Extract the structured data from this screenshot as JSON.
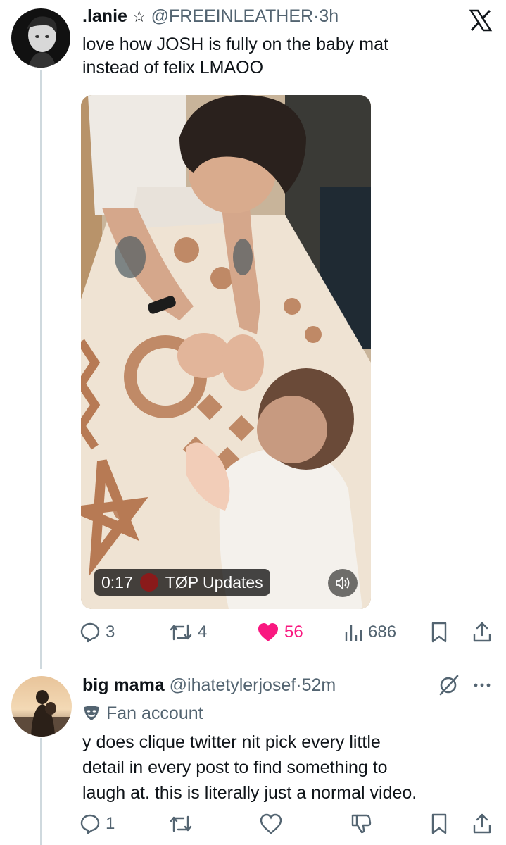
{
  "tweet1": {
    "display_name": ".lanie",
    "handle": "@FREEINLEATHER",
    "separator": "·",
    "time": "3h",
    "text_lines": [
      "love how JOSH is fully on the baby mat",
      "instead of felix LMAOO"
    ],
    "avatar_icon": "profile-photo",
    "video": {
      "duration": "0:17",
      "source_label": "TØP Updates",
      "mute_icon": "speaker-icon"
    },
    "actions": {
      "replies": "3",
      "retweets": "4",
      "likes": "56",
      "views": "686"
    },
    "like_color": "#f91880"
  },
  "tweet2": {
    "display_name": "big mama",
    "handle": "@ihatetylerjosef",
    "separator": "·",
    "time": "52m",
    "label": "Fan account",
    "text_lines": [
      "y does clique twitter nit pick every little",
      "detail in every post to find something to",
      "laugh at. this is literally just a normal video."
    ],
    "actions": {
      "replies": "1"
    }
  },
  "colors": {
    "text": "#0f1419",
    "secondary": "#536471",
    "thread_line": "#cfd9de"
  }
}
